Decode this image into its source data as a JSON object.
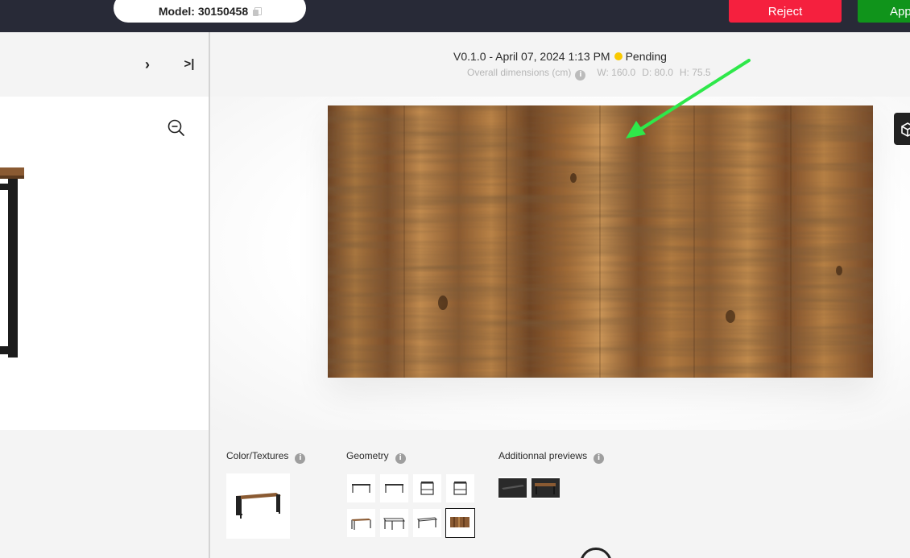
{
  "topbar": {
    "model_label": "Model: 30150458",
    "reject_label": "Reject",
    "approve_label": "App"
  },
  "version": {
    "text": "V0.1.0 - April 07, 2024 1:13 PM",
    "status": "Pending",
    "status_color": "#f9c900"
  },
  "dimensions": {
    "label": "Overall dimensions (cm)",
    "width": "W: 160.0",
    "depth": "D: 80.0",
    "height": "H: 75.5"
  },
  "sections": {
    "color_textures": "Color/Textures",
    "geometry": "Geometry",
    "additional_previews": "Additionnal previews"
  },
  "icons": {
    "next": "chevron-right-icon",
    "last": "skip-to-end-icon",
    "zoom": "zoom-out-icon",
    "cube": "cube-icon",
    "info": "info-icon",
    "copy": "copy-icon"
  },
  "colors": {
    "topbar": "#282a37",
    "reject": "#f5203e",
    "approve": "#10941b",
    "annotation_arrow": "#2ee84a"
  }
}
